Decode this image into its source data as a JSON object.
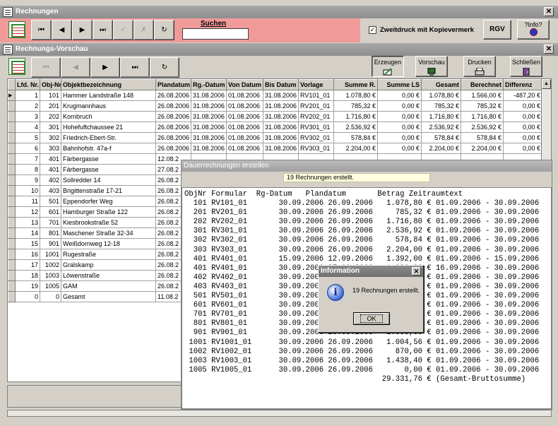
{
  "main_window": {
    "title": "Rechnungen",
    "search_label": "Suchen",
    "search_value": "",
    "checkbox_label": "Zweitdruck mit Kopievermerk",
    "checkbox_checked": true,
    "rgv_label": "RGV",
    "info_label": "?Info?"
  },
  "preview_window": {
    "title": "Rechnungs-Vorschau",
    "buttons": {
      "erzeugen": "Erzeugen",
      "vorschau": "Vorschau",
      "drucken": "Drucken",
      "schliessen": "Schließen"
    },
    "columns": [
      "Lfd. Nr.",
      "Obj-Nr.",
      "Objektbezeichnung",
      "Plandatum",
      "Rg.-Datum",
      "Von Datum",
      "Bis Datum",
      "Vorlage",
      "Summe R.",
      "Summe LS",
      "Gesamt",
      "Berechnet",
      "Differenz"
    ],
    "rows": [
      [
        "1",
        "101",
        "Hammer Landstraße 148",
        "26.08.2006",
        "31.08.2006",
        "01.08.2006",
        "31.08.2006",
        "RV101_01",
        "1.078,80 €",
        "0,00 €",
        "1.078,80 €",
        "1.566,00 €",
        "-487,20 €"
      ],
      [
        "2",
        "201",
        "Krugmannhaus",
        "26.08.2006",
        "31.08.2006",
        "01.08.2006",
        "31.08.2006",
        "RV201_01",
        "785,32 €",
        "0,00 €",
        "785,32 €",
        "785,32 €",
        "0,00 €"
      ],
      [
        "3",
        "202",
        "Kornbruch",
        "26.08.2006",
        "31.08.2006",
        "01.08.2006",
        "31.08.2006",
        "RV202_01",
        "1.716,80 €",
        "0,00 €",
        "1.716,80 €",
        "1.716,80 €",
        "0,00 €"
      ],
      [
        "4",
        "301",
        "Hohefuftchaussee 21",
        "26.08.2006",
        "31.08.2006",
        "01.08.2006",
        "31.08.2006",
        "RV301_01",
        "2.536,92 €",
        "0,00 €",
        "2.536,92 €",
        "2.536,92 €",
        "0,00 €"
      ],
      [
        "5",
        "302",
        "Friedrich-Ebert-Str.",
        "26.08.2006",
        "31.08.2006",
        "01.08.2006",
        "31.08.2006",
        "RV302_01",
        "578,84 €",
        "0,00 €",
        "578,84 €",
        "578,84 €",
        "0,00 €"
      ],
      [
        "6",
        "303",
        "Bahnhofstr. 47a-f",
        "26.08.2006",
        "31.08.2006",
        "01.08.2006",
        "31.08.2006",
        "RV303_01",
        "2.204,00 €",
        "0,00 €",
        "2.204,00 €",
        "2.204,00 €",
        "0,00 €"
      ],
      [
        "7",
        "401",
        "Färbergasse",
        "12.08.2",
        "",
        "",
        "",
        "",
        "",
        "",
        "",
        "",
        ""
      ],
      [
        "8",
        "401",
        "Färbergasse",
        "27.08.2",
        "",
        "",
        "",
        "",
        "",
        "",
        "",
        "",
        ""
      ],
      [
        "9",
        "402",
        "Sollredder 14",
        "26.08.2",
        "",
        "",
        "",
        "",
        "",
        "",
        "",
        "",
        ""
      ],
      [
        "10",
        "403",
        "Brigittenstraße 17-21",
        "26.08.2",
        "",
        "",
        "",
        "",
        "",
        "",
        "",
        "",
        ""
      ],
      [
        "11",
        "501",
        "Eppendorfer Weg",
        "26.08.2",
        "",
        "",
        "",
        "",
        "",
        "",
        "",
        "",
        ""
      ],
      [
        "12",
        "601",
        "Hamburger Straße 122",
        "26.08.2",
        "",
        "",
        "",
        "",
        "",
        "",
        "",
        "",
        ""
      ],
      [
        "13",
        "701",
        "Kiesbrookstraße 52",
        "26.08.2",
        "",
        "",
        "",
        "",
        "",
        "",
        "",
        "",
        ""
      ],
      [
        "14",
        "801",
        "Maschener Straße 32-34",
        "26.08.2",
        "",
        "",
        "",
        "",
        "",
        "",
        "",
        "",
        ""
      ],
      [
        "15",
        "901",
        "Weißdornweg 12-18",
        "26.08.2",
        "",
        "",
        "",
        "",
        "",
        "",
        "",
        "",
        ""
      ],
      [
        "16",
        "1001",
        "Rugestraße",
        "26.08.2",
        "",
        "",
        "",
        "",
        "",
        "",
        "",
        "",
        ""
      ],
      [
        "17",
        "1002",
        "Gralskamp",
        "26.08.2",
        "",
        "",
        "",
        "",
        "",
        "",
        "",
        "",
        ""
      ],
      [
        "18",
        "1003",
        "Löwenstraße",
        "26.08.2",
        "",
        "",
        "",
        "",
        "",
        "",
        "",
        "",
        ""
      ],
      [
        "19",
        "1005",
        "GAM",
        "26.08.2",
        "",
        "",
        "",
        "",
        "",
        "",
        "",
        "",
        ""
      ],
      [
        "0",
        "0",
        "Gesamt",
        "11.08.2",
        "",
        "",
        "",
        "",
        "",
        "",
        "",
        "",
        ""
      ]
    ]
  },
  "dauer_panel": {
    "title": "Dauerrechnungen erstellen",
    "status": "19 Rechnungen erstellt.",
    "text_lines": [
      "ObjNr Formular  Rg-Datum   Plandatum       Betrag Zeitraumtext",
      "  101 RV101_01       30.09.2006 26.09.2006   1.078,80 € 01.09.2006 - 30.09.2006",
      "  201 RV201_01       30.09.2006 26.09.2006     785,32 € 01.09.2006 - 30.09.2006",
      "  202 RV202_01       30.09.2006 26.09.2006   1.716,80 € 01.09.2006 - 30.09.2006",
      "  301 RV301_01       30.09.2006 26.09.2006   2.536,92 € 01.09.2006 - 30.09.2006",
      "  302 RV302_01       30.09.2006 26.09.2006     578,84 € 01.09.2006 - 30.09.2006",
      "  303 RV303_01       30.09.2006 26.09.2006   2.204,00 € 01.09.2006 - 30.09.2006",
      "  401 RV401_01       15.09.2006 12.09.2006   1.392,00 € 01.09.2006 - 15.09.2006",
      "  401 RV401_01       30.09.2006 27.09.2006   1.000,00 € 16.09.2006 - 30.09.2006",
      "  402 RV402_01       30.09.2006 26.09.2006     996,00 € 01.09.2006 - 30.09.2006",
      "  403 RV403_01       30.09.2006 26.09.2006   1.000,00 € 01.09.2006 - 30.09.2006",
      "  501 RV501_01       30.09.2006 26.09.2006   1.000,00 € 01.09.2006 - 30.09.2006",
      "  601 RV601_01       30.09.2006 26.09.2006   1.000,00 € 01.09.2006 - 30.09.2006",
      "  701 RV701_01       30.09.2006 26.09.2006   1.000,00 € 01.09.2006 - 30.09.2006",
      "  801 RV801_01       30.09.2006 26.09.2006   1.000,00 € 01.09.2006 - 30.09.2006",
      "  901 RV901_01       30.09.2006 26.09.2006   1.000,00 € 01.09.2006 - 30.09.2006",
      " 1001 RV1001_01      30.09.2006 26.09.2006   1.004,56 € 01.09.2006 - 30.09.2006",
      " 1002 RV1002_01      30.09.2006 26.09.2006     870,00 € 01.09.2006 - 30.09.2006",
      " 1003 RV1003_01      30.09.2006 26.09.2006   1.438,40 € 01.09.2006 - 30.09.2006",
      " 1005 RV1005_01      30.09.2006 26.09.2006       0,00 € 01.09.2006 - 30.09.2006",
      "                                            29.331,76 € (Gesamt-Bruttosumme)"
    ]
  },
  "dialog": {
    "title": "Information",
    "message": "19 Rechnungen erstellt.",
    "ok_label": "OK"
  },
  "colors": {
    "search_area": "#f09a9a",
    "status_bar": "#ffffe0"
  }
}
